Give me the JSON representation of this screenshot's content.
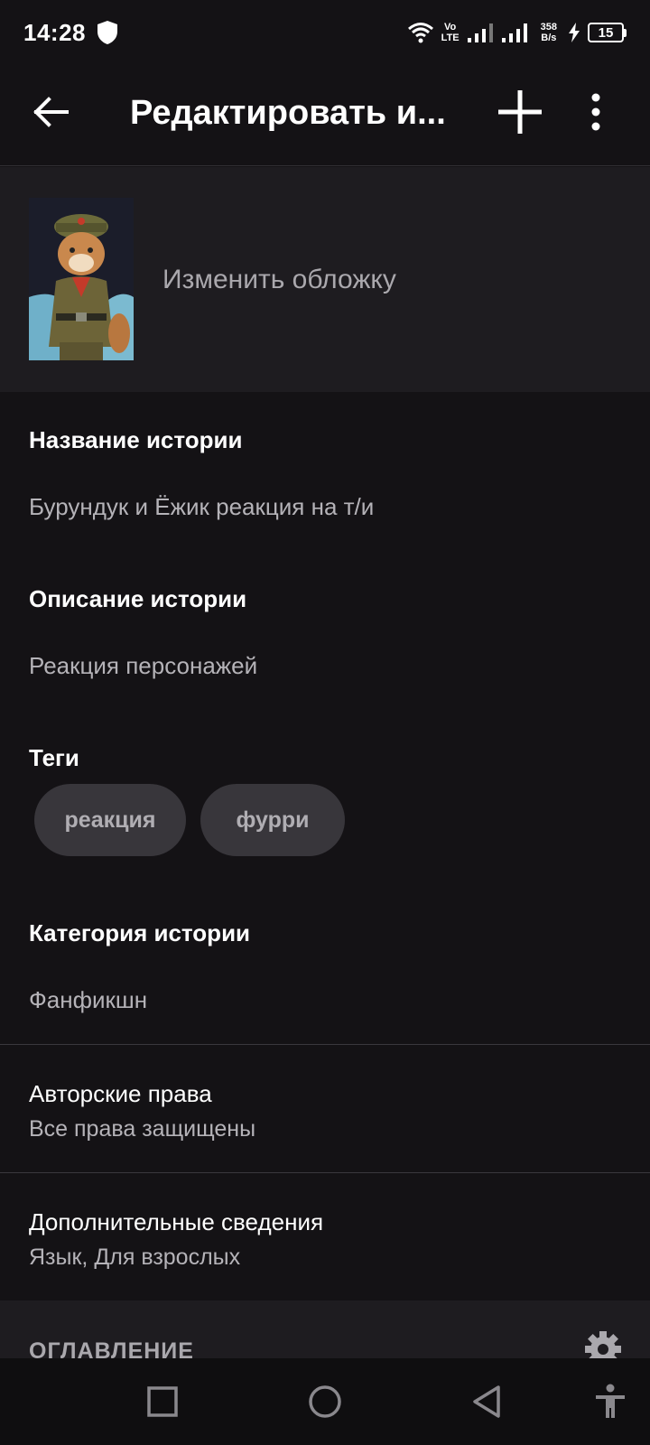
{
  "status": {
    "time": "14:28",
    "volte_top": "Vo",
    "volte_bottom": "LTE",
    "speed_top": "358",
    "speed_bottom": "B/s",
    "battery": "15"
  },
  "appbar": {
    "title": "Редактировать и..."
  },
  "cover": {
    "change_label": "Изменить обложку"
  },
  "fields": {
    "title_label": "Название истории",
    "title_value": "Бурундук и Ёжик реакция на т/и",
    "description_label": "Описание истории",
    "description_value": "Реакция персонажей",
    "tags_label": "Теги",
    "tags": [
      "реакция",
      "фурри"
    ],
    "category_label": "Категория истории",
    "category_value": "Фанфикшн"
  },
  "rows": {
    "copyright_title": "Авторские права",
    "copyright_value": "Все права защищены",
    "extra_title": "Дополнительные сведения",
    "extra_value": "Язык, Для взрослых"
  },
  "toc": {
    "label": "ОГЛАВЛЕНИЕ"
  },
  "colors": {
    "background": "#141215",
    "surface": "#1e1c20",
    "tag_bg": "#38363b",
    "text_primary": "#ffffff",
    "text_secondary": "#b5b3b8"
  },
  "icons": [
    "shield-icon",
    "wifi-icon",
    "signal-icon",
    "charging-icon",
    "battery-icon",
    "back-arrow-icon",
    "plus-icon",
    "more-vert-icon",
    "gear-icon",
    "square-icon",
    "circle-icon",
    "triangle-back-icon",
    "accessibility-icon"
  ]
}
